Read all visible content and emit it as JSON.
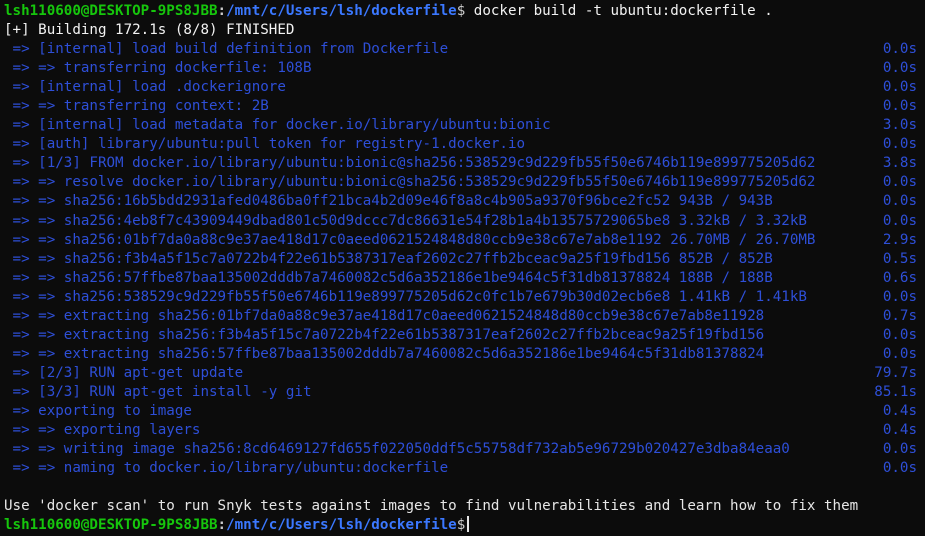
{
  "prompt": {
    "user_host": "lsh110600@DESKTOP-9PS8JBB",
    "separator": ":",
    "path": "/mnt/c/Users/lsh/dockerfile",
    "symbol": "$"
  },
  "command": " docker build -t ubuntu:dockerfile .",
  "status": "[+] Building 172.1s (8/8) FINISHED",
  "steps": [
    {
      "text": " => [internal] load build definition from Dockerfile",
      "time": "0.0s"
    },
    {
      "text": " => => transferring dockerfile: 108B",
      "time": "0.0s"
    },
    {
      "text": " => [internal] load .dockerignore",
      "time": "0.0s"
    },
    {
      "text": " => => transferring context: 2B",
      "time": "0.0s"
    },
    {
      "text": " => [internal] load metadata for docker.io/library/ubuntu:bionic",
      "time": "3.0s"
    },
    {
      "text": " => [auth] library/ubuntu:pull token for registry-1.docker.io",
      "time": "0.0s"
    },
    {
      "text": " => [1/3] FROM docker.io/library/ubuntu:bionic@sha256:538529c9d229fb55f50e6746b119e899775205d62",
      "time": "3.8s"
    },
    {
      "text": " => => resolve docker.io/library/ubuntu:bionic@sha256:538529c9d229fb55f50e6746b119e899775205d62",
      "time": "0.0s"
    },
    {
      "text": " => => sha256:16b5bdd2931afed0486ba0ff21bca4b2d09e46f8a8c4b905a9370f96bce2fc52 943B / 943B",
      "time": "0.0s"
    },
    {
      "text": " => => sha256:4eb8f7c43909449dbad801c50d9dccc7dc86631e54f28b1a4b13575729065be8 3.32kB / 3.32kB",
      "time": "0.0s"
    },
    {
      "text": " => => sha256:01bf7da0a88c9e37ae418d17c0aeed0621524848d80ccb9e38c67e7ab8e1192 26.70MB / 26.70MB",
      "time": "2.9s"
    },
    {
      "text": " => => sha256:f3b4a5f15c7a0722b4f22e61b5387317eaf2602c27ffb2bceac9a25f19fbd156 852B / 852B",
      "time": "0.5s"
    },
    {
      "text": " => => sha256:57ffbe87baa135002dddb7a7460082c5d6a352186e1be9464c5f31db81378824 188B / 188B",
      "time": "0.6s"
    },
    {
      "text": " => => sha256:538529c9d229fb55f50e6746b119e899775205d62c0fc1b7e679b30d02ecb6e8 1.41kB / 1.41kB",
      "time": "0.0s"
    },
    {
      "text": " => => extracting sha256:01bf7da0a88c9e37ae418d17c0aeed0621524848d80ccb9e38c67e7ab8e11928",
      "time": "0.7s"
    },
    {
      "text": " => => extracting sha256:f3b4a5f15c7a0722b4f22e61b5387317eaf2602c27ffb2bceac9a25f19fbd156",
      "time": "0.0s"
    },
    {
      "text": " => => extracting sha256:57ffbe87baa135002dddb7a7460082c5d6a352186e1be9464c5f31db81378824",
      "time": "0.0s"
    },
    {
      "text": " => [2/3] RUN apt-get update",
      "time": "79.7s"
    },
    {
      "text": " => [3/3] RUN apt-get install -y git",
      "time": "85.1s"
    },
    {
      "text": " => exporting to image",
      "time": "0.4s"
    },
    {
      "text": " => => exporting layers",
      "time": "0.4s"
    },
    {
      "text": " => => writing image sha256:8cd6469127fd655f022050ddf5c55758df732ab5e96729b020427e3dba84eaa0",
      "time": "0.0s"
    },
    {
      "text": " => => naming to docker.io/library/ubuntu:dockerfile",
      "time": "0.0s"
    }
  ],
  "notice": "Use 'docker scan' to run Snyk tests against images to find vulnerabilities and learn how to fix them",
  "colors": {
    "background": "#0c0c0c",
    "user_host": "#16c60c",
    "path": "#3b78ff",
    "step_text": "#2e4fd8",
    "foreground": "#cccccc"
  }
}
